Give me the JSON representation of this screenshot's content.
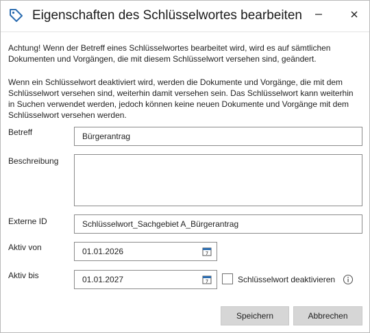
{
  "window": {
    "title": "Eigenschaften des Schlüsselwortes bearbeiten",
    "icon": "tag-icon",
    "minimize_glyph": "—",
    "close_glyph": "✕"
  },
  "notices": {
    "warning": "Achtung! Wenn der Betreff eines Schlüsselwortes bearbeitet wird, wird es auf sämtlichen Dokumenten und Vorgängen, die mit diesem Schlüsselwort versehen sind, geändert.",
    "info": "Wenn ein Schlüsselwort deaktiviert wird, werden die Dokumente und Vorgänge, die mit dem Schlüsselwort versehen sind, weiterhin damit versehen sein. Das Schlüsselwort kann weiterhin in Suchen verwendet werden, jedoch können keine neuen Dokumente und Vorgänge mit dem Schlüsselwort versehen werden."
  },
  "form": {
    "betreff": {
      "label": "Betreff",
      "value": "Bürgerantrag"
    },
    "beschreibung": {
      "label": "Beschreibung",
      "value": ""
    },
    "externe_id": {
      "label": "Externe ID",
      "value": "Schlüsselwort_Sachgebiet A_Bürgerantrag"
    },
    "aktiv_von": {
      "label": "Aktiv von",
      "value": "01.01.2026",
      "icon": "calendar-icon"
    },
    "aktiv_bis": {
      "label": "Aktiv bis",
      "value": "01.01.2027",
      "icon": "calendar-icon"
    },
    "deaktivieren": {
      "label": "Schlüsselwort deaktivieren",
      "checked": false
    },
    "info_icon": "info-icon"
  },
  "buttons": {
    "save": "Speichern",
    "cancel": "Abbrechen"
  },
  "colors": {
    "accent": "#2b6cb0",
    "button_bg": "#d6d6d6",
    "field_border": "#8a8a8a"
  }
}
